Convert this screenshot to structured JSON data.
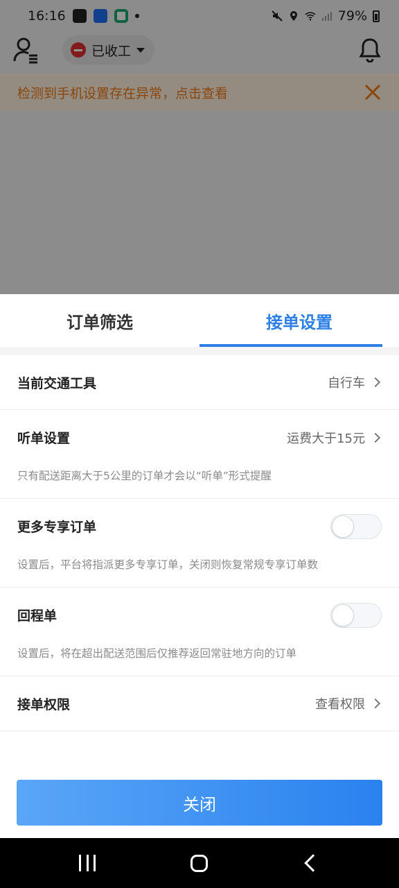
{
  "status_bar": {
    "time": "16:16",
    "battery": "79%",
    "icons": [
      "gallery-icon",
      "alipay-icon",
      "app-icon",
      "notification-dot-icon",
      "mute-icon",
      "location-icon",
      "wifi-icon",
      "signal-icon",
      "battery-icon"
    ]
  },
  "header": {
    "status_label": "已收工",
    "icons": [
      "user-menu-icon",
      "bell-icon"
    ]
  },
  "warning": {
    "text": "检测到手机设置存在异常，点击查看"
  },
  "tabs": [
    {
      "label": "订单筛选",
      "active": false
    },
    {
      "label": "接单设置",
      "active": true
    }
  ],
  "settings": {
    "transport": {
      "label": "当前交通工具",
      "value": "自行车"
    },
    "listen": {
      "label": "听单设置",
      "value": "运费大于15元",
      "note": "只有配送距离大于5公里的订单才会以“听单”形式提醒"
    },
    "exclusive": {
      "label": "更多专享订单",
      "enabled": false,
      "note": "设置后，平台将指派更多专享订单，关闭则恢复常规专享订单数"
    },
    "return_order": {
      "label": "回程单",
      "enabled": false,
      "note": "设置后，将在超出配送范围后仅推荐返回常驻地方向的订单"
    },
    "permission": {
      "label": "接单权限",
      "value": "查看权限"
    }
  },
  "close_button": "关闭",
  "colors": {
    "accent": "#2d7fe6",
    "warning_text": "#f07a12",
    "warning_bg": "#fff1df",
    "stop_red": "#e0302f"
  }
}
